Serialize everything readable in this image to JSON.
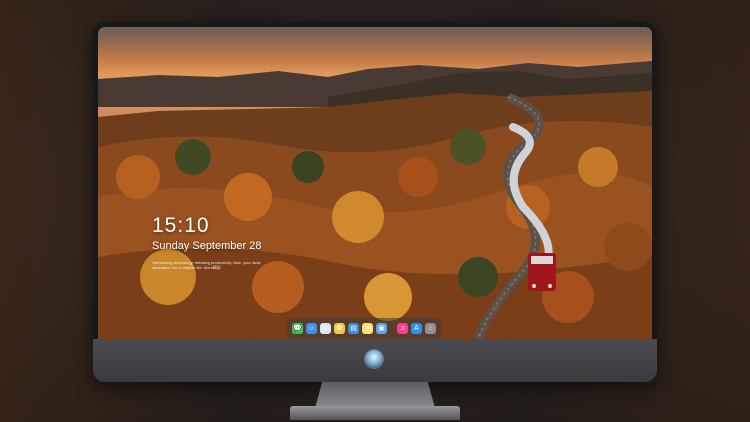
{
  "lock_screen": {
    "time": "15:10",
    "date": "Sunday September 28",
    "caption": "Harnessing technology, breaking productivity. Mac, your ideal companion for a smarter life. More精彩"
  },
  "dock": {
    "apps": [
      {
        "name": "messages-icon",
        "color": "#34c759",
        "glyph": "💬"
      },
      {
        "name": "finder-icon",
        "color": "#3f8ef5",
        "glyph": "☺"
      },
      {
        "name": "safari-icon",
        "color": "#d8e8f5",
        "glyph": "◎"
      },
      {
        "name": "photos-icon",
        "color": "#f2c94c",
        "glyph": "✿"
      },
      {
        "name": "preview-icon",
        "color": "#3b8fd9",
        "glyph": "▤"
      },
      {
        "name": "notes-icon",
        "color": "#f7e27a",
        "glyph": "≡"
      },
      {
        "name": "image-capture-icon",
        "color": "#5aa7e8",
        "glyph": "▣"
      },
      {
        "name": "music-icon",
        "color": "#fc3c8f",
        "glyph": "♫"
      },
      {
        "name": "app-store-icon",
        "color": "#2f8ff0",
        "glyph": "A"
      },
      {
        "name": "trash-icon",
        "color": "#8e8e93",
        "glyph": "⌂"
      }
    ]
  }
}
